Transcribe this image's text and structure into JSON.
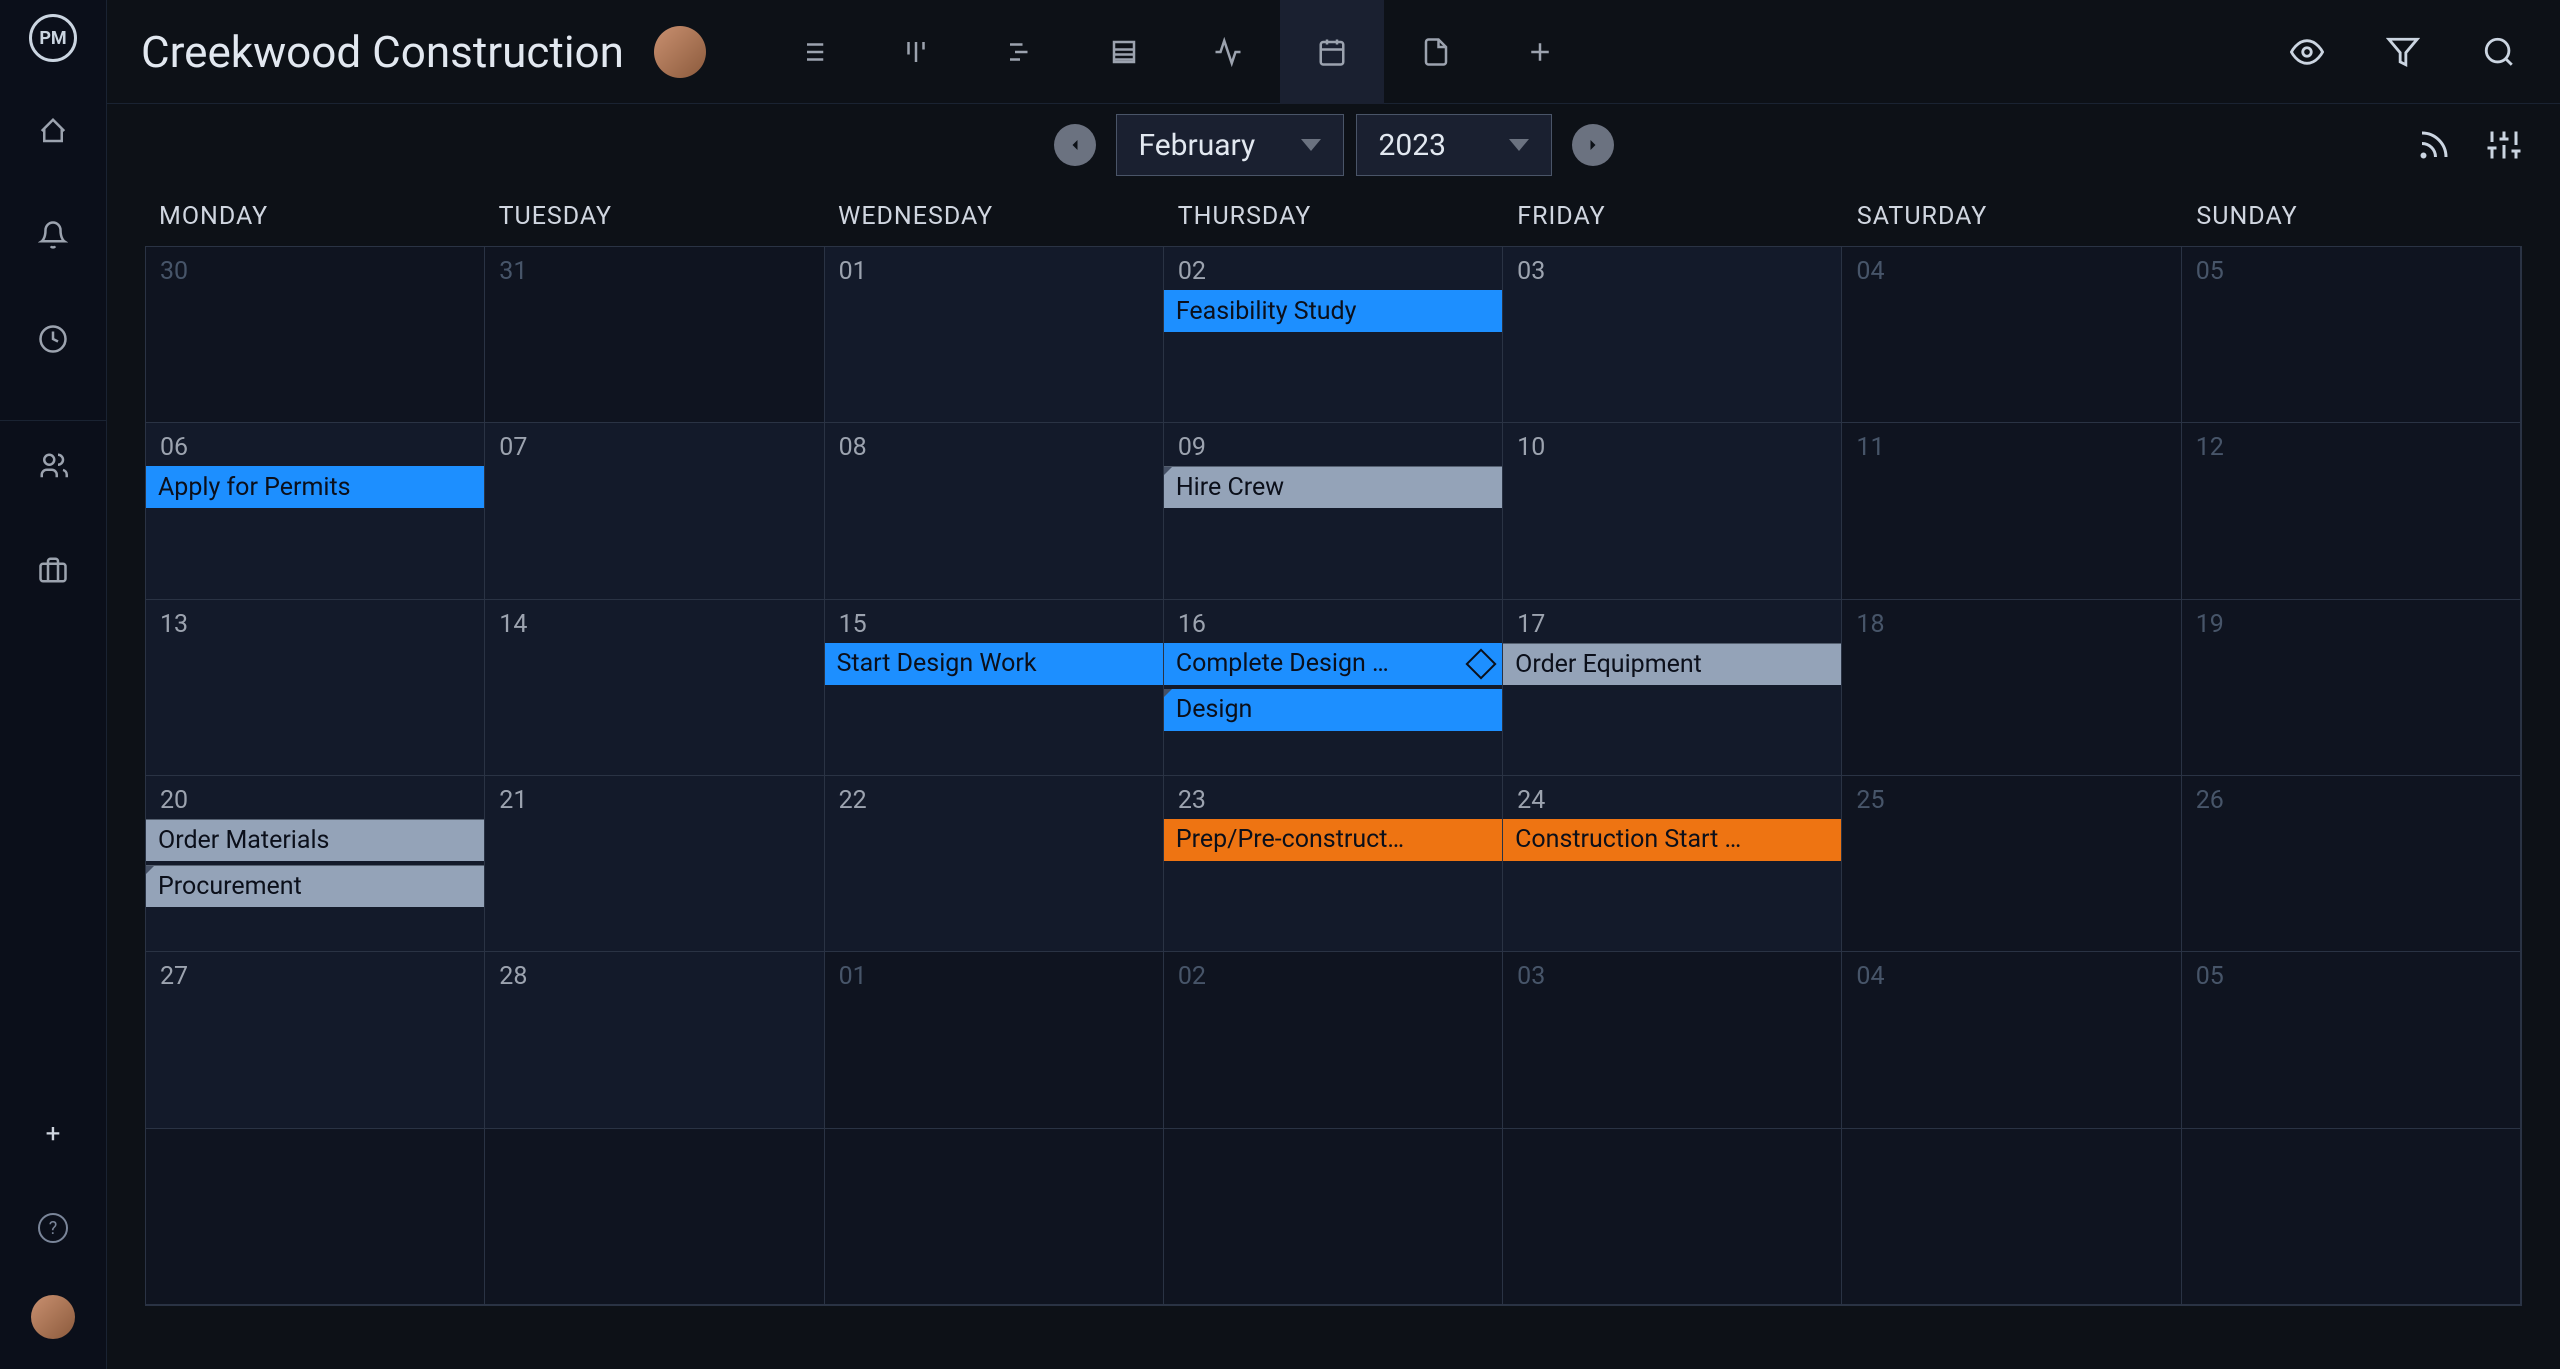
{
  "app": {
    "logo_text": "PM",
    "project_title": "Creekwood Construction"
  },
  "sidebar": {
    "items": [
      {
        "name": "home-icon"
      },
      {
        "name": "bell-icon"
      },
      {
        "name": "clock-icon"
      },
      {
        "name": "team-icon"
      },
      {
        "name": "briefcase-icon"
      }
    ]
  },
  "view_tabs": [
    {
      "name": "list-view",
      "active": false
    },
    {
      "name": "board-view",
      "active": false
    },
    {
      "name": "gantt-view",
      "active": false
    },
    {
      "name": "sheet-view",
      "active": false
    },
    {
      "name": "activity-view",
      "active": false
    },
    {
      "name": "calendar-view",
      "active": true
    },
    {
      "name": "file-view",
      "active": false
    },
    {
      "name": "add-view",
      "active": false
    }
  ],
  "header_actions": [
    "visibility-icon",
    "filter-icon",
    "search-icon"
  ],
  "calendar": {
    "month": "February",
    "year": "2023",
    "weekdays": [
      "MONDAY",
      "TUESDAY",
      "WEDNESDAY",
      "THURSDAY",
      "FRIDAY",
      "SATURDAY",
      "SUNDAY"
    ],
    "weeks": [
      [
        {
          "num": "30",
          "outside": true
        },
        {
          "num": "31",
          "outside": true
        },
        {
          "num": "01",
          "outside": false
        },
        {
          "num": "02",
          "outside": false
        },
        {
          "num": "03",
          "outside": false
        },
        {
          "num": "04",
          "outside": true
        },
        {
          "num": "05",
          "outside": true
        }
      ],
      [
        {
          "num": "06",
          "outside": false
        },
        {
          "num": "07",
          "outside": false
        },
        {
          "num": "08",
          "outside": false
        },
        {
          "num": "09",
          "outside": false
        },
        {
          "num": "10",
          "outside": false
        },
        {
          "num": "11",
          "outside": true
        },
        {
          "num": "12",
          "outside": true
        }
      ],
      [
        {
          "num": "13",
          "outside": false
        },
        {
          "num": "14",
          "outside": false
        },
        {
          "num": "15",
          "outside": false
        },
        {
          "num": "16",
          "outside": false
        },
        {
          "num": "17",
          "outside": false
        },
        {
          "num": "18",
          "outside": true
        },
        {
          "num": "19",
          "outside": true
        }
      ],
      [
        {
          "num": "20",
          "outside": false
        },
        {
          "num": "21",
          "outside": false
        },
        {
          "num": "22",
          "outside": false
        },
        {
          "num": "23",
          "outside": false
        },
        {
          "num": "24",
          "outside": false
        },
        {
          "num": "25",
          "outside": true
        },
        {
          "num": "26",
          "outside": true
        }
      ],
      [
        {
          "num": "27",
          "outside": false
        },
        {
          "num": "28",
          "outside": false
        },
        {
          "num": "01",
          "outside": true
        },
        {
          "num": "02",
          "outside": true
        },
        {
          "num": "03",
          "outside": true
        },
        {
          "num": "04",
          "outside": true
        },
        {
          "num": "05",
          "outside": true
        }
      ],
      []
    ],
    "events": {
      "feasibility": "Feasibility Study",
      "permits": "Apply for Permits",
      "hire_crew": "Hire Crew",
      "start_design": "Start Design Work",
      "complete_design": "Complete Design …",
      "design": "Design",
      "order_equipment": "Order Equipment",
      "order_materials": "Order Materials",
      "procurement": "Procurement",
      "prep": "Prep/Pre-construct…",
      "construction_start": "Construction Start …"
    }
  }
}
